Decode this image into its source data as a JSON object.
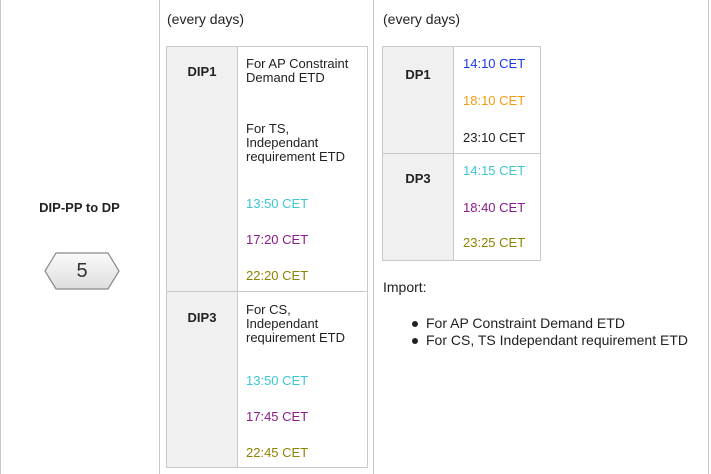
{
  "left_cell": {
    "title": "DIP-PP to DP",
    "step_number": "5"
  },
  "middle": {
    "note": "(every days)",
    "rows": [
      {
        "label": "DIP1",
        "descriptions": [
          "For  AP Constraint Demand ETD",
          "For TS, Independant requirement ETD"
        ],
        "times": [
          "13:50 CET",
          "17:20 CET",
          "22:20 CET"
        ]
      },
      {
        "label": "DIP3",
        "descriptions": [
          "For CS, Independant requirement ETD"
        ],
        "times": [
          "13:50 CET",
          "17:45 CET",
          "22:45 CET"
        ]
      }
    ]
  },
  "right": {
    "note": "(every days)",
    "rows": [
      {
        "label": "DP1",
        "times": [
          "14:10 CET",
          "18:10 CET",
          "23:10 CET"
        ]
      },
      {
        "label": "DP3",
        "times": [
          "14:15 CET",
          "18:40 CET",
          "23:25 CET"
        ]
      }
    ],
    "import_label": "Import:",
    "import_items": [
      "For  AP Constraint Demand ETD",
      "For CS, TS Independant requirement ETD"
    ]
  },
  "colors": {
    "blue": "#1a3ae6",
    "orange": "#f39c12",
    "black": "#222222",
    "cyan": "#3cc6d4",
    "purple": "#8b1a8b",
    "olive": "#8c8400",
    "border": "#c9c9c9",
    "label_bg": "#f0f0f0"
  },
  "icons": {
    "step_badge": "hexagon-badge-icon"
  }
}
